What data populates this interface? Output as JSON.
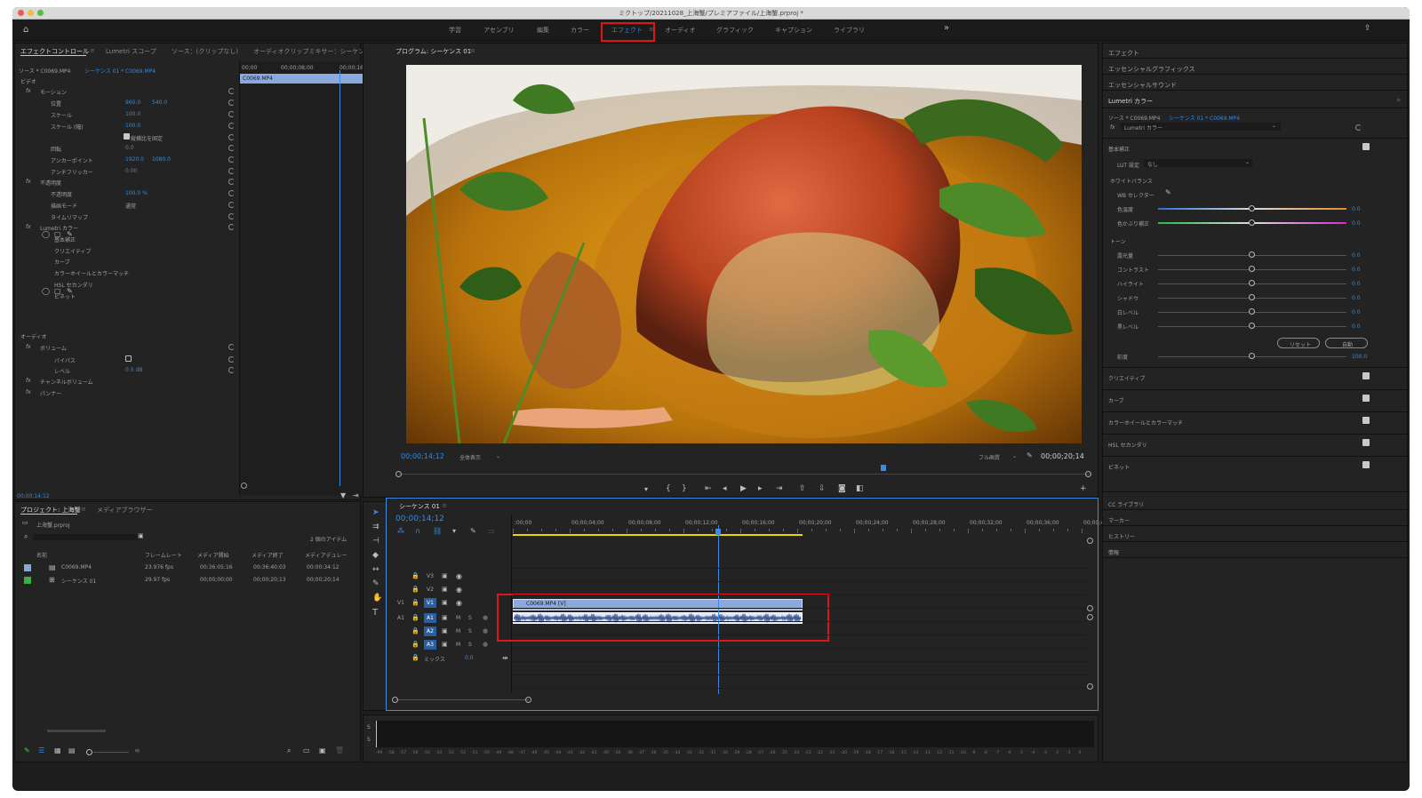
{
  "window": {
    "title": "ミクトップ/20211028_上海蟹/プレミアファイル/上海蟹.prproj *"
  },
  "workspaces": {
    "tabs": [
      "学習",
      "アセンブリ",
      "編集",
      "カラー",
      "エフェクト",
      "オーディオ",
      "グラフィック",
      "キャプション",
      "ライブラリ"
    ],
    "active": "エフェクト",
    "more": "»"
  },
  "effect_controls": {
    "tabs": [
      "エフェクトコントロール",
      "Lumetri スコープ",
      "ソース：(クリップなし)",
      "オーディオクリップミキサー：シーケンス 0"
    ],
    "source_label": "ソース * C0069.MP4",
    "sequence_label": "シーケンス 01 * C0069.MP4",
    "timeline_times": [
      "00;00",
      "00;00;08;00",
      "00;00;16;00"
    ],
    "clip_name": "C0069.MP4",
    "sections": {
      "video": "ビデオ",
      "audio": "オーディオ"
    },
    "rows": [
      {
        "label": "モーション",
        "value": "",
        "fx": true
      },
      {
        "label": "位置",
        "value": "960.0",
        "value2": "540.0"
      },
      {
        "label": "スケール",
        "value": "100.0"
      },
      {
        "label": "スケール (幅)",
        "value": "100.0"
      },
      {
        "label": "",
        "value": "縦横比を固定"
      },
      {
        "label": "回転",
        "value": "0.0"
      },
      {
        "label": "アンカーポイント",
        "value": "1920.0",
        "value2": "1080.0"
      },
      {
        "label": "アンチフリッカー",
        "value": "0.00"
      },
      {
        "label": "不透明度",
        "value": "",
        "fx": true
      },
      {
        "label": "不透明度",
        "value": "100.0 %"
      },
      {
        "label": "描画モード",
        "value": "通常"
      },
      {
        "label": "タイムリマップ",
        "value": ""
      },
      {
        "label": "Lumetri カラー",
        "value": "",
        "fx": true
      },
      {
        "label": "基本補正",
        "value": ""
      },
      {
        "label": "クリエイティブ",
        "value": ""
      },
      {
        "label": "カーブ",
        "value": ""
      },
      {
        "label": "カラーホイールとカラーマッチ",
        "value": ""
      },
      {
        "label": "HSL セカンダリ",
        "value": ""
      },
      {
        "label": "ビネット",
        "value": ""
      }
    ],
    "audio_rows": [
      {
        "label": "ボリューム",
        "value": "",
        "fx": true
      },
      {
        "label": "バイパス",
        "value": ""
      },
      {
        "label": "レベル",
        "value": "0.0 dB"
      },
      {
        "label": "チャンネルボリューム",
        "value": "",
        "fx": true
      },
      {
        "label": "パンナー",
        "value": "",
        "fx": true
      }
    ],
    "current_time": "00;00;14;12"
  },
  "program": {
    "title": "プログラム: シーケンス 01",
    "timecode": "00;00;14;12",
    "fit": "全体表示",
    "quality": "フル画質",
    "duration": "00;00;20;14"
  },
  "project": {
    "tabs": [
      "プロジェクト: 上海蟹",
      "メディアブラウザー"
    ],
    "file": "上海蟹.prproj",
    "item_count": "2 個のアイテム",
    "columns": [
      "名前",
      "フレームレート",
      "メディア開始",
      "メディア終了",
      "メディアデュレー"
    ],
    "items": [
      {
        "name": "C0069.MP4",
        "fps": "23.976 fps",
        "start": "00:36:05:16",
        "end": "00:36:40:03",
        "dur": "00:00:34:12",
        "color": "#8aa7d8"
      },
      {
        "name": "シーケンス 01",
        "fps": "29.97 fps",
        "start": "00;00;00;00",
        "end": "00;00;20;13",
        "dur": "00;00;20;14",
        "color": "#34b34a"
      }
    ]
  },
  "timeline": {
    "title": "シーケンス 01",
    "timecode": "00;00;14;12",
    "ruler": [
      ";00;00",
      "00;00;04;00",
      "00;00;08;00",
      "00;00;12;00",
      "00;00;16;00",
      "00;00;20;00",
      "00;00;24;00",
      "00;00;28;00",
      "00;00;32;00",
      "00;00;36;00",
      "00;00;4"
    ],
    "video_tracks": [
      "V3",
      "V2",
      "V1"
    ],
    "audio_tracks": [
      "A1",
      "A2",
      "A3"
    ],
    "source_v": "V1",
    "source_a": "A1",
    "mix_label": "ミックス",
    "mix_value": "0.0",
    "clip_label": "C0069.MP4 [V]",
    "playhead_fraction": 0.7
  },
  "audio_meter": {
    "labels": [
      "S",
      "S"
    ],
    "scale": [
      "-99",
      "-58",
      "-57",
      "-56",
      "-55",
      "-54",
      "-53",
      "-52",
      "-51",
      "-50",
      "-49",
      "-48",
      "-47",
      "-46",
      "-45",
      "-44",
      "-43",
      "-42",
      "-41",
      "-40",
      "-39",
      "-38",
      "-37",
      "-36",
      "-35",
      "-34",
      "-33",
      "-32",
      "-31",
      "-30",
      "-29",
      "-28",
      "-27",
      "-26",
      "-25",
      "-24",
      "-23",
      "-22",
      "-21",
      "-20",
      "-19",
      "-18",
      "-17",
      "-16",
      "-15",
      "-14",
      "-13",
      "-12",
      "-11",
      "-10",
      "-9",
      "-8",
      "-7",
      "-6",
      "-5",
      "-4",
      "-3",
      "-2",
      "-1",
      "0"
    ]
  },
  "right_panel": {
    "headers": [
      "エフェクト",
      "エッセンシャルグラフィックス",
      "エッセンシャルサウンド"
    ],
    "lumetri_title": "Lumetri カラー",
    "source_label": "ソース * C0069.MP4",
    "sequence_label": "シーケンス 01 * C0069.MP4",
    "effect_select": "Lumetri カラー",
    "basic": "基本補正",
    "lut_label": "LUT 設定",
    "lut_value": "なし",
    "white_balance": "ホワイトバランス",
    "wb_selector": "WB セレクター",
    "temp_label": "色温度",
    "temp_value": "0.0",
    "tint_label": "色かぶり補正",
    "tint_value": "0.0",
    "tone": "トーン",
    "tone_rows": [
      {
        "label": "露光量",
        "value": "0.0"
      },
      {
        "label": "コントラスト",
        "value": "0.0"
      },
      {
        "label": "ハイライト",
        "value": "0.0"
      },
      {
        "label": "シャドウ",
        "value": "0.0"
      },
      {
        "label": "白レベル",
        "value": "0.0"
      },
      {
        "label": "黒レベル",
        "value": "0.0"
      }
    ],
    "reset_btn": "リセット",
    "auto_btn": "自動",
    "saturation_label": "彩度",
    "saturation_value": "100.0",
    "sections": [
      "クリエイティブ",
      "カーブ",
      "カラーホイールとカラーマッチ",
      "HSL セカンダリ",
      "ビネット"
    ],
    "bottom": [
      "CC ライブラリ",
      "マーカー",
      "ヒストリー",
      "情報"
    ]
  },
  "colors": {
    "accent": "#2d8ceb",
    "highlight": "#e0151c",
    "clip_video": "#8aa9dd",
    "work_area": "#e8d800"
  }
}
